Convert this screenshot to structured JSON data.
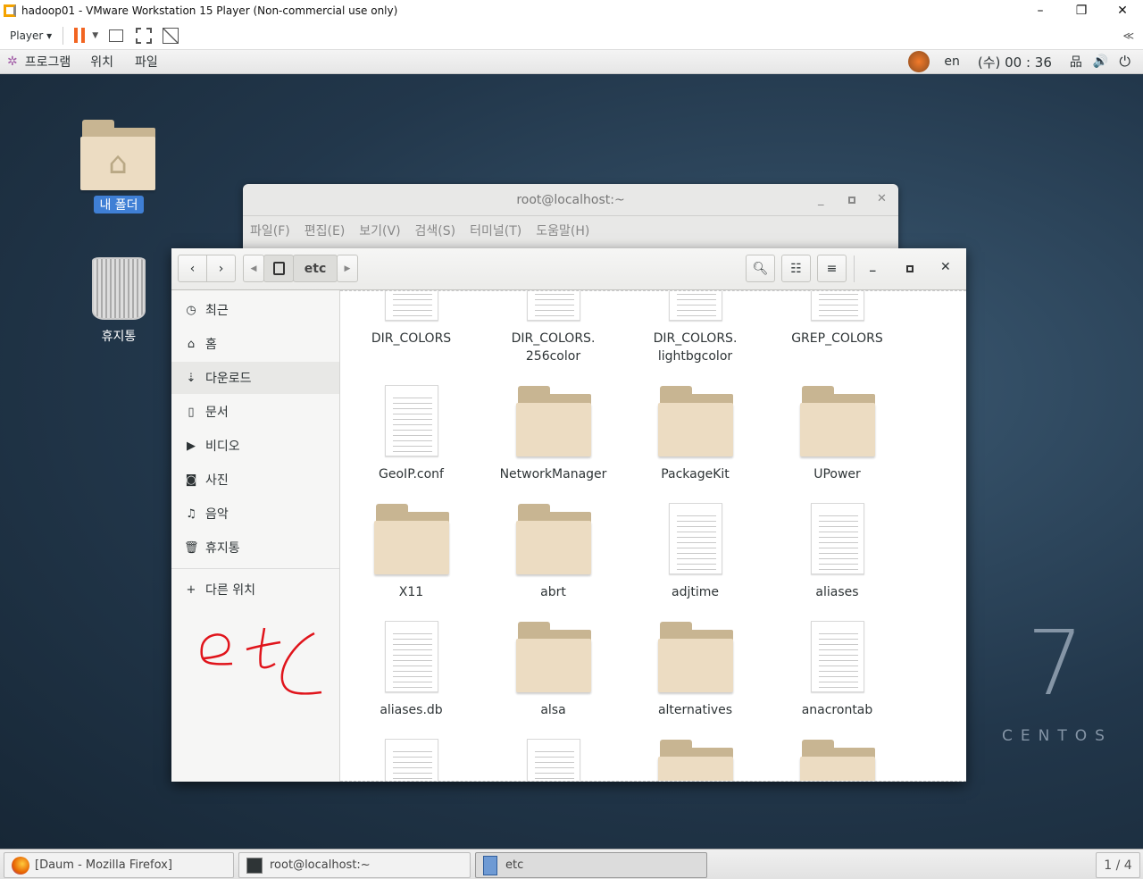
{
  "vmware": {
    "title": "hadoop01 - VMware Workstation 15 Player (Non-commercial use only)",
    "player_menu": "Player",
    "minimize": "–",
    "restore": "❐",
    "close": "✕",
    "collapse": "≪"
  },
  "gnome": {
    "applications": "프로그램",
    "places": "위치",
    "files": "파일",
    "lang": "en",
    "clock": "(수) 00 : 36"
  },
  "desktop": {
    "home_label": "내 폴더",
    "trash_label": "휴지통",
    "os_version": "7",
    "os_name": "CENTOS"
  },
  "terminal": {
    "title": "root@localhost:~",
    "menu": [
      "파일(F)",
      "편집(E)",
      "보기(V)",
      "검색(S)",
      "터미널(T)",
      "도움말(H)"
    ]
  },
  "files": {
    "path_current": "etc",
    "sidebar": [
      {
        "label": "최근",
        "icon": "clock-icon",
        "glyph": "◷"
      },
      {
        "label": "홈",
        "icon": "home-icon",
        "glyph": "⌂"
      },
      {
        "label": "다운로드",
        "icon": "download-icon",
        "glyph": "⇣"
      },
      {
        "label": "문서",
        "icon": "document-icon",
        "glyph": "▯"
      },
      {
        "label": "비디오",
        "icon": "video-icon",
        "glyph": "▶"
      },
      {
        "label": "사진",
        "icon": "camera-icon",
        "glyph": "◙"
      },
      {
        "label": "음악",
        "icon": "music-icon",
        "glyph": "♫"
      },
      {
        "label": "휴지통",
        "icon": "trash-icon",
        "glyph": "🗑"
      }
    ],
    "other_locations": "다른 위치",
    "annotation": "etc",
    "items": [
      {
        "name": "DIR_COLORS",
        "type": "file"
      },
      {
        "name": "DIR_COLORS.\n256color",
        "type": "file"
      },
      {
        "name": "DIR_COLORS.\nlightbgcolor",
        "type": "file"
      },
      {
        "name": "GREP_COLORS",
        "type": "file"
      },
      {
        "name": "GeoIP.conf",
        "type": "file"
      },
      {
        "name": "NetworkManager",
        "type": "folder"
      },
      {
        "name": "PackageKit",
        "type": "folder"
      },
      {
        "name": "UPower",
        "type": "folder"
      },
      {
        "name": "X11",
        "type": "folder"
      },
      {
        "name": "abrt",
        "type": "folder"
      },
      {
        "name": "adjtime",
        "type": "file"
      },
      {
        "name": "aliases",
        "type": "file"
      },
      {
        "name": "aliases.db",
        "type": "file"
      },
      {
        "name": "alsa",
        "type": "folder"
      },
      {
        "name": "alternatives",
        "type": "folder"
      },
      {
        "name": "anacrontab",
        "type": "file"
      },
      {
        "name": "",
        "type": "file"
      },
      {
        "name": "",
        "type": "file"
      },
      {
        "name": "",
        "type": "folder"
      },
      {
        "name": "",
        "type": "folder"
      }
    ]
  },
  "taskbar": {
    "tasks": [
      "[Daum - Mozilla Firefox]",
      "root@localhost:~",
      "etc"
    ],
    "workspace": "1 / 4"
  }
}
